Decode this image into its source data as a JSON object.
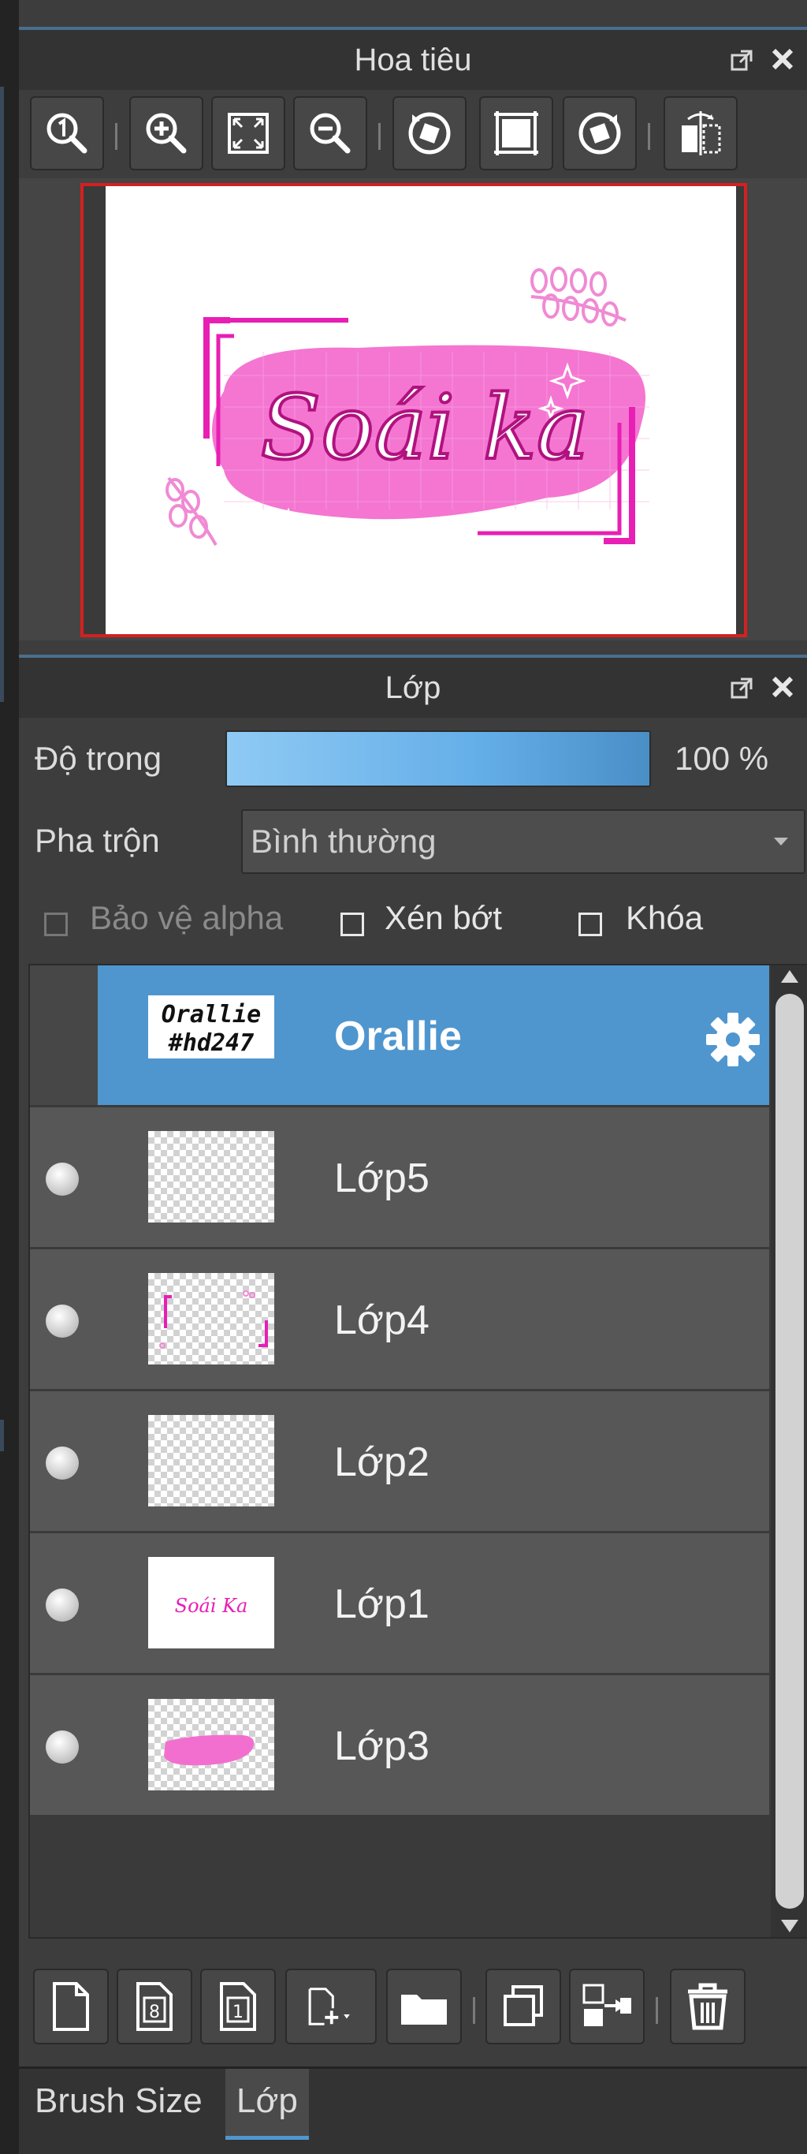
{
  "navigator": {
    "title": "Hoa tiêu",
    "tools": [
      "zoom-actual-icon",
      "zoom-in-icon",
      "fit-screen-icon",
      "zoom-out-icon",
      "rotate-left-icon",
      "fit-canvas-icon",
      "rotate-right-icon",
      "flip-horizontal-icon"
    ],
    "preview_text": "Soái ka"
  },
  "layers_panel": {
    "title": "Lớp",
    "opacity_label": "Độ trong",
    "opacity_value": "100 %",
    "opacity_fraction": 1.0,
    "blend_label": "Pha trộn",
    "blend_value": "Bình thường",
    "protect_alpha": "Bảo vệ alpha",
    "clipping": "Xén bớt",
    "lock": "Khóa",
    "layers": [
      {
        "name": "Orallie",
        "selected": true,
        "thumb_text_1": "Orallie",
        "thumb_text_2": "#hd247"
      },
      {
        "name": "Lớp5",
        "selected": false
      },
      {
        "name": "Lớp4",
        "selected": false
      },
      {
        "name": "Lớp2",
        "selected": false
      },
      {
        "name": "Lớp1",
        "selected": false,
        "thumb_text_1": "Soái Ka"
      },
      {
        "name": "Lớp3",
        "selected": false
      }
    ]
  },
  "tabs": [
    "Brush Size",
    "Lớp"
  ],
  "colors": {
    "accent": "#4f96cf",
    "magenta": "#e81fb4",
    "pink": "#f36fcf"
  }
}
